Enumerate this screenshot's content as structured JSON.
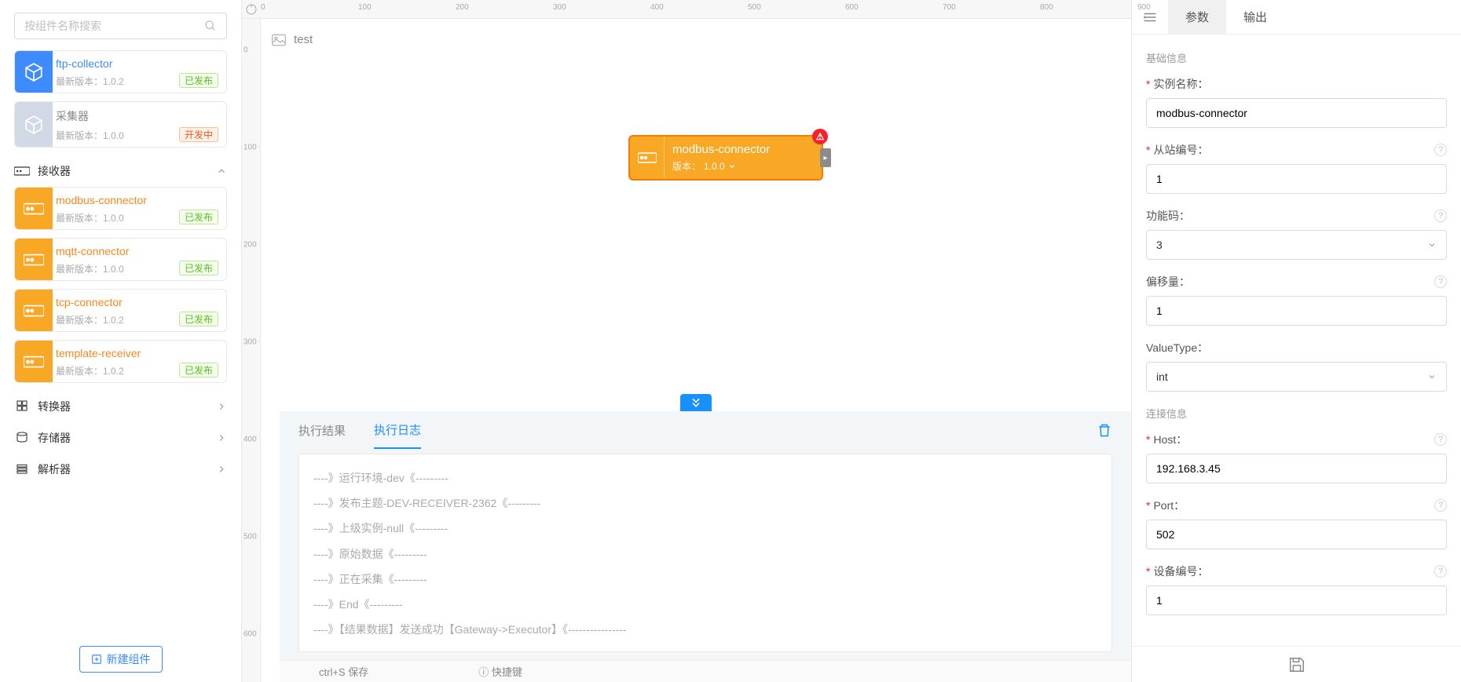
{
  "search": {
    "placeholder": "按组件名称搜索"
  },
  "cards_top": [
    {
      "name": "ftp-collector",
      "version_label": "最新版本：",
      "version": "1.0.2",
      "badge": "已发布",
      "badge_class": "pub",
      "theme": "blue"
    },
    {
      "name": "采集器",
      "version_label": "最新版本：",
      "version": "1.0.0",
      "badge": "开发中",
      "badge_class": "dev",
      "theme": "gray"
    }
  ],
  "category_receiver": "接收器",
  "receiver_cards": [
    {
      "name": "modbus-connector",
      "version_label": "最新版本：",
      "version": "1.0.0",
      "badge": "已发布"
    },
    {
      "name": "mqtt-connector",
      "version_label": "最新版本：",
      "version": "1.0.0",
      "badge": "已发布"
    },
    {
      "name": "tcp-connector",
      "version_label": "最新版本：",
      "version": "1.0.2",
      "badge": "已发布"
    },
    {
      "name": "template-receiver",
      "version_label": "最新版本：",
      "version": "1.0.2",
      "badge": "已发布"
    }
  ],
  "categories_collapsed": [
    {
      "label": "转换器"
    },
    {
      "label": "存储器"
    },
    {
      "label": "解析器"
    }
  ],
  "new_component": "新建组件",
  "canvas": {
    "title": "test",
    "node_name": "modbus-connector",
    "node_version_label": "版本：",
    "node_version": "1.0.0"
  },
  "ruler_h": [
    "0",
    "100",
    "200",
    "300",
    "400",
    "500",
    "600",
    "700",
    "800",
    "900"
  ],
  "ruler_v": [
    "0",
    "100",
    "200",
    "300",
    "400",
    "500",
    "600"
  ],
  "bottom_tabs": {
    "result": "执行结果",
    "log": "执行日志"
  },
  "log_lines": [
    "----》运行环境-dev《---------",
    "----》发布主题-DEV-RECEIVER-2362《---------",
    "----》上级实例-null《---------",
    "----》原始数据《---------",
    "----》正在采集《---------",
    "----》End《---------",
    "----》【结果数据】发送成功【Gateway->Executor】《----------------"
  ],
  "status": {
    "save": "ctrl+S 保存",
    "shortcut": "快捷键"
  },
  "right": {
    "tab_params": "参数",
    "tab_output": "输出",
    "section_basic": "基础信息",
    "labels": {
      "instance": "实例名称：",
      "station": "从站编号：",
      "func": "功能码：",
      "offset": "偏移量：",
      "vtype": "ValueType：",
      "host": "Host：",
      "port": "Port：",
      "devno": "设备编号："
    },
    "values": {
      "instance": "modbus-connector",
      "station": "1",
      "func": "3",
      "offset": "1",
      "vtype": "int",
      "host": "192.168.3.45",
      "port": "502",
      "devno": "1"
    },
    "section_conn": "连接信息"
  }
}
